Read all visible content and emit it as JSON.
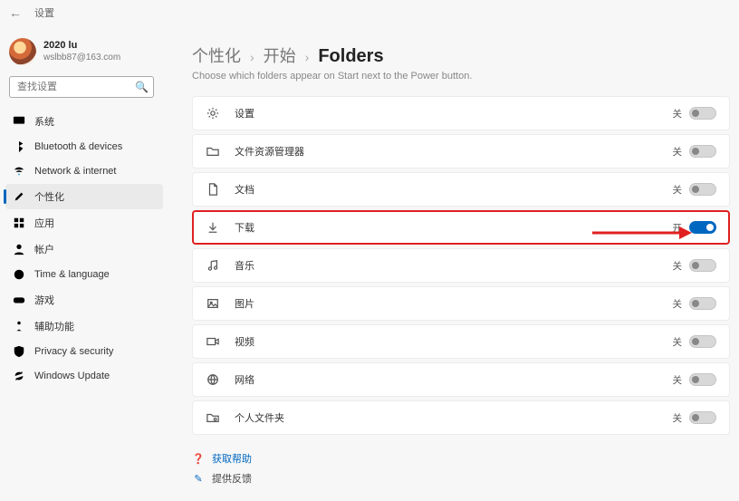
{
  "titlebar": {
    "title": "设置"
  },
  "profile": {
    "name": "2020 lu",
    "email": "wslbb87@163.com"
  },
  "search": {
    "placeholder": "查找设置"
  },
  "nav": [
    {
      "key": "system",
      "label": "系统",
      "icon": "monitor-icon",
      "color": "icon-blue",
      "selected": false
    },
    {
      "key": "bluetooth",
      "label": "Bluetooth & devices",
      "icon": "bt-icon",
      "color": "icon-blue",
      "selected": false
    },
    {
      "key": "network",
      "label": "Network & internet",
      "icon": "wifi-icon",
      "color": "icon-cyan",
      "selected": false
    },
    {
      "key": "personal",
      "label": "个性化",
      "icon": "brush-icon",
      "color": "icon-orange",
      "selected": true
    },
    {
      "key": "apps",
      "label": "应用",
      "icon": "grid-icon",
      "color": "icon-slate",
      "selected": false
    },
    {
      "key": "accounts",
      "label": "帐户",
      "icon": "person-icon",
      "color": "icon-gray",
      "selected": false
    },
    {
      "key": "time",
      "label": "Time & language",
      "icon": "clock-icon",
      "color": "icon-gray",
      "selected": false
    },
    {
      "key": "gaming",
      "label": "游戏",
      "icon": "game-icon",
      "color": "icon-gray",
      "selected": false
    },
    {
      "key": "access",
      "label": "辅助功能",
      "icon": "access-icon",
      "color": "icon-blue",
      "selected": false
    },
    {
      "key": "privacy",
      "label": "Privacy & security",
      "icon": "shield-icon",
      "color": "icon-slate",
      "selected": false
    },
    {
      "key": "update",
      "label": "Windows Update",
      "icon": "update-icon",
      "color": "icon-blue",
      "selected": false
    }
  ],
  "breadcrumb": {
    "level1": "个性化",
    "level2": "开始",
    "current": "Folders"
  },
  "page_subtitle": "Choose which folders appear on Start next to the Power button.",
  "state_labels": {
    "on": "开",
    "off": "关"
  },
  "folders": [
    {
      "key": "settings",
      "label": "设置",
      "icon": "gear-icon",
      "on": false
    },
    {
      "key": "explorer",
      "label": "文件资源管理器",
      "icon": "folder-icon",
      "on": false
    },
    {
      "key": "documents",
      "label": "文档",
      "icon": "doc-icon",
      "on": false
    },
    {
      "key": "downloads",
      "label": "下载",
      "icon": "download-icon",
      "on": true,
      "highlight": true
    },
    {
      "key": "music",
      "label": "音乐",
      "icon": "music-icon",
      "on": false
    },
    {
      "key": "pictures",
      "label": "图片",
      "icon": "image-icon",
      "on": false
    },
    {
      "key": "videos",
      "label": "视频",
      "icon": "video-icon",
      "on": false
    },
    {
      "key": "network",
      "label": "网络",
      "icon": "globe-icon",
      "on": false
    },
    {
      "key": "personalf",
      "label": "个人文件夹",
      "icon": "pfolder-icon",
      "on": false
    }
  ],
  "footer": {
    "help": "获取帮助",
    "feedback": "提供反馈"
  }
}
